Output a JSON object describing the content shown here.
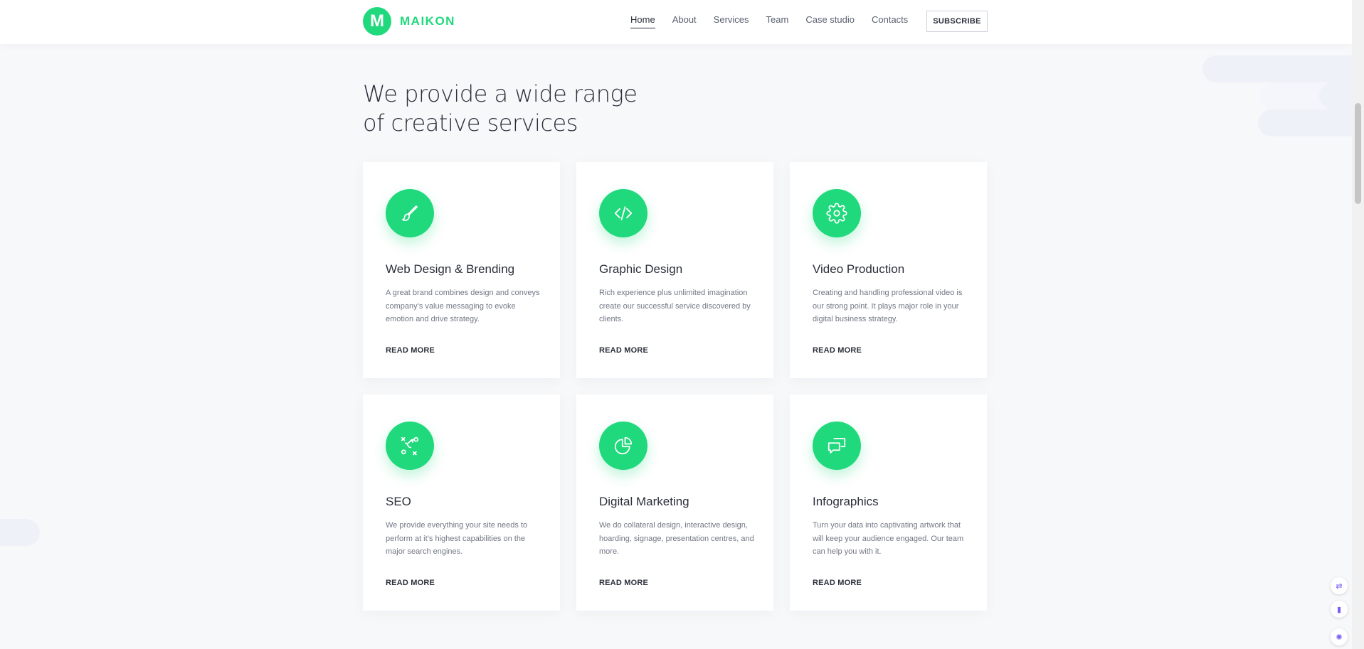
{
  "header": {
    "logo_letter": "M",
    "logo_text": "MAIKON",
    "nav": [
      "Home",
      "About",
      "Services",
      "Team",
      "Case studio",
      "Contacts"
    ],
    "subscribe_label": "SUBSCRIBE"
  },
  "section": {
    "heading_line1": "We provide a wide range",
    "heading_line2": "of creative services"
  },
  "cards": [
    {
      "icon": "brush-icon",
      "title": "Web Design & Brending",
      "desc": "A great brand combines design and conveys company’s value messaging to evoke emotion and drive strategy.",
      "link": "READ MORE"
    },
    {
      "icon": "code-icon",
      "title": "Graphic Design",
      "desc": "Rich experience plus unlimited imagination create our successful service discovered by clients.",
      "link": "READ MORE"
    },
    {
      "icon": "gear-icon",
      "title": "Video Production",
      "desc": "Creating and handling professional video is our strong point. It plays major role in your digital business strategy.",
      "link": "READ MORE"
    },
    {
      "icon": "strategy-icon",
      "title": "SEO",
      "desc": "We provide everything your site needs to perform at it’s highest capabilities on the major search engines.",
      "link": "READ MORE"
    },
    {
      "icon": "pie-chart-icon",
      "title": "Digital Marketing",
      "desc": "We do collateral design, interactive design, hoarding, signage, presentation centres, and more.",
      "link": "READ MORE"
    },
    {
      "icon": "chat-icon",
      "title": "Infographics",
      "desc": "Turn your data into captivating artwork that will keep your audience engaged. Our team can help you with it.",
      "link": "READ MORE"
    }
  ],
  "colors": {
    "accent": "#20d97c",
    "text": "#2b2f3a",
    "muted": "#727784"
  }
}
